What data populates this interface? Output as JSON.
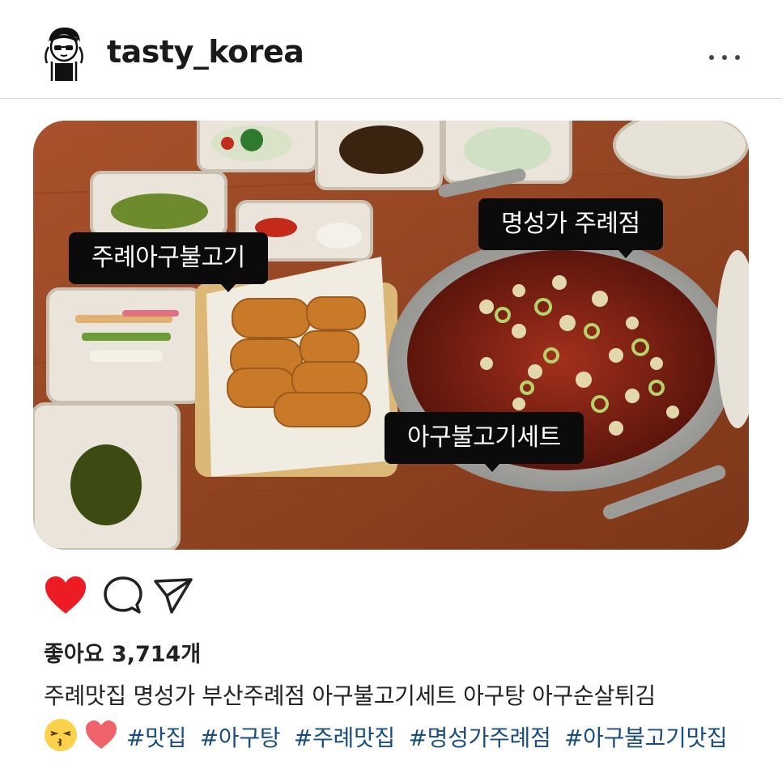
{
  "post": {
    "username": "tasty_korea",
    "more_icon": "ellipsis-icon",
    "photo_tags": [
      {
        "label": "주례아구불고기"
      },
      {
        "label": "명성가 주례점"
      },
      {
        "label": "아구불고기세트"
      }
    ],
    "actions": {
      "like_icon": "heart-filled-icon",
      "comment_icon": "comment-bubble-icon",
      "share_icon": "paper-plane-icon",
      "like_color": "#ed1b24"
    },
    "likes_text": "좋아요 3,714개",
    "caption": "주례맛집 명성가 부산주례점 아구불고기세트 아구탕 아구순살튀김",
    "emojis": [
      "kissing-face-emoji",
      "red-heart-emoji"
    ],
    "hashtags": [
      "#맛집",
      "#아구탕",
      "#주례맛집",
      "#명성가주례점",
      "#아구불고기맛집"
    ],
    "hashtag_color": "#1a4d80"
  }
}
